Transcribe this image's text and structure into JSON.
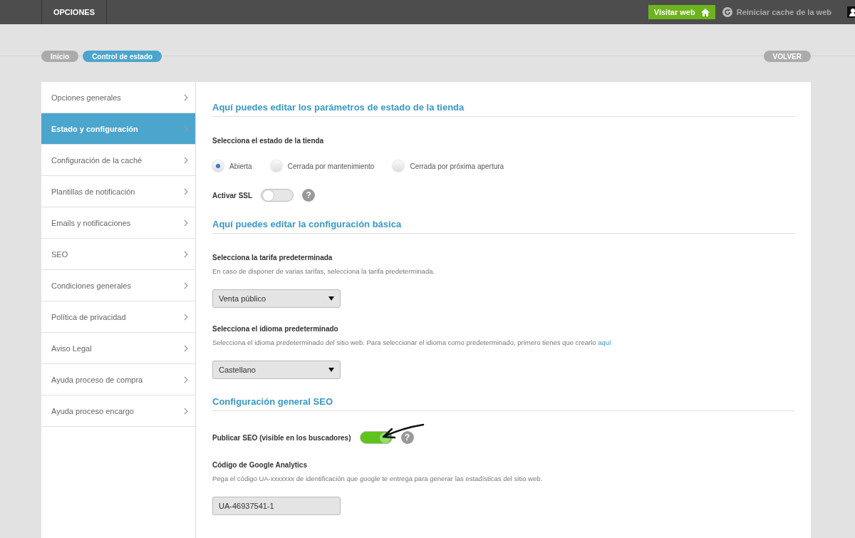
{
  "topbar": {
    "menu": "OPCIONES",
    "visit_button": "Visitar web",
    "reset_cache": "Reiniciar cache de la web"
  },
  "breadcrumbs": [
    {
      "label": "Inicio",
      "selected": false
    },
    {
      "label": "Control de estado",
      "selected": true
    }
  ],
  "back_button": "VOLVER",
  "sidebar": {
    "items": [
      {
        "label": "Opciones generales",
        "selected": false
      },
      {
        "label": "Estado y configuración",
        "selected": true
      },
      {
        "label": "Configuración de la caché",
        "selected": false
      },
      {
        "label": "Plantillas de notificación",
        "selected": false
      },
      {
        "label": "Emails y notificaciones",
        "selected": false
      },
      {
        "label": "SEO",
        "selected": false
      },
      {
        "label": "Condiciones generales",
        "selected": false
      },
      {
        "label": "Política de privacidad",
        "selected": false
      },
      {
        "label": "Aviso Legal",
        "selected": false
      },
      {
        "label": "Ayuda proceso de compra",
        "selected": false
      },
      {
        "label": "Ayuda proceso encargo",
        "selected": false
      }
    ]
  },
  "sections": [
    {
      "title": "Aquí puedes editar los parámetros de estado de la tienda",
      "fields": [
        {
          "kind": "radio",
          "label": "Selecciona el estado de la tienda",
          "options": [
            {
              "label": "Abierta",
              "selected": true
            },
            {
              "label": "Cerrada por mantenimiento",
              "selected": false
            },
            {
              "label": "Cerrada por próxima apertura",
              "selected": false
            }
          ]
        },
        {
          "kind": "toggle",
          "label": "Activar SSL",
          "on": false,
          "help": "?"
        }
      ]
    },
    {
      "title": "Aquí puedes editar la configuración básica",
      "fields": [
        {
          "kind": "select",
          "label": "Selecciona la tarifa predeterminada",
          "description": "En caso de disponer de varias tarifas, selecciona la tarifa predeterminada.",
          "value": "Venta público"
        },
        {
          "kind": "select",
          "label": "Selecciona el idioma predeterminado",
          "description": "Selecciona el idioma predeterminado del sitio web. Para seleccionar el idioma como predeterminado, primero tienes que crearlo",
          "link": "aquí",
          "value": "Castellano"
        }
      ]
    },
    {
      "title": "Configuración general SEO",
      "fields": [
        {
          "kind": "toggle",
          "label": "Publicar SEO (visible en los buscadores)",
          "on": true,
          "help": "?",
          "annotated": true
        },
        {
          "kind": "text",
          "label": "Código de Google Analytics",
          "description": "Pega el código UA-xxxxxxx de identificación que google te entrega para generar las estadísticas del sitio web.",
          "value": "UA-46937541-1"
        }
      ]
    }
  ]
}
